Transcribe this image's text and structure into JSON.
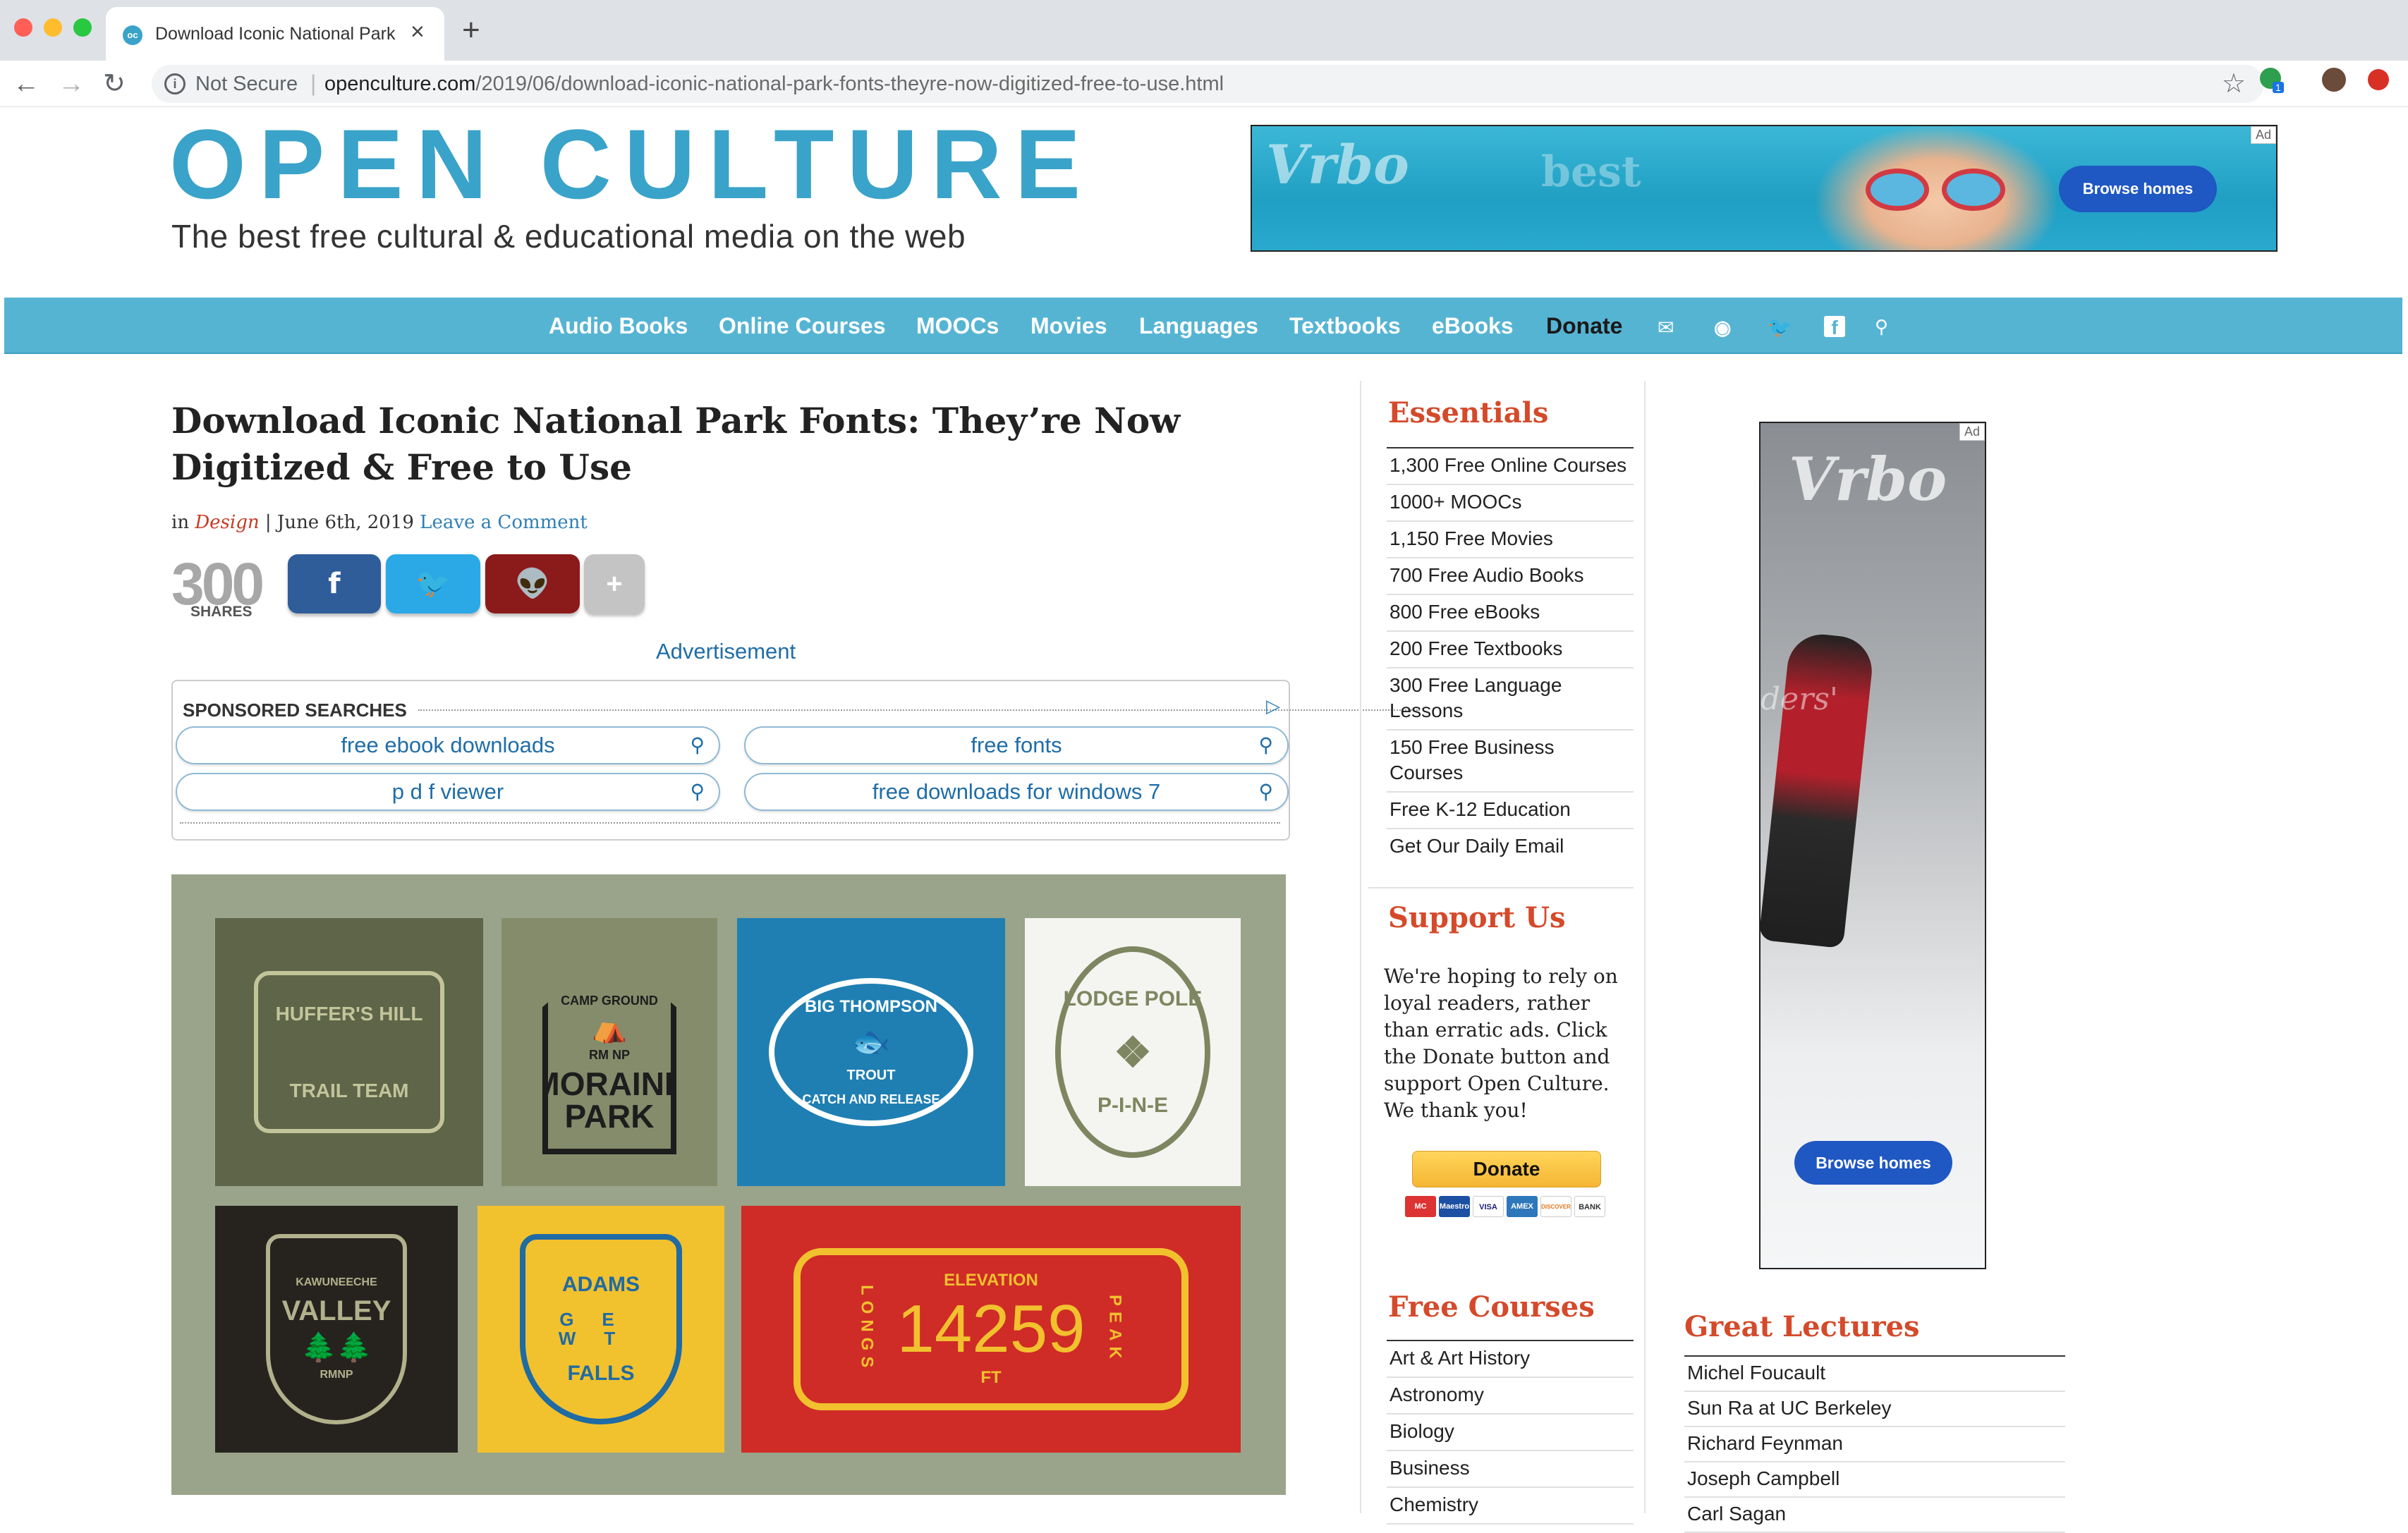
{
  "browser": {
    "tab_title": "Download Iconic National Park",
    "tab_favicon": "oc",
    "url_security": "Not Secure",
    "url_host": "openculture.com",
    "url_path": "/2019/06/download-iconic-national-park-fonts-theyre-now-digitized-free-to-use.html",
    "extension_badge": "1"
  },
  "header": {
    "logo": "OPEN CULTURE",
    "tagline": "The best free cultural & educational media on the web"
  },
  "top_ad": {
    "brand": "Vrbo",
    "text": "best",
    "button": "Browse homes",
    "ad_tag": "Ad"
  },
  "nav": {
    "items": [
      "Audio Books",
      "Online Courses",
      "MOOCs",
      "Movies",
      "Languages",
      "Textbooks",
      "eBooks",
      "Donate"
    ],
    "icons": [
      "mail-icon",
      "rss-icon",
      "twitter-icon",
      "facebook-icon",
      "search-icon"
    ]
  },
  "article": {
    "title": "Download Iconic National Park Fonts: They’re Now Digitized & Free to Use",
    "meta_in": "in",
    "category": "Design",
    "date": " | June 6th, 2019 ",
    "comment_link": "Leave a Comment",
    "share_count": "300",
    "share_label": "SHARES",
    "share_buttons": {
      "facebook": "f",
      "twitter": "t",
      "reddit": "r",
      "more": "+"
    },
    "advertisement_label": "Advertisement"
  },
  "sponsored": {
    "label": "SPONSORED SEARCHES",
    "searches": [
      "free ebook downloads",
      "free fonts",
      "p d f viewer",
      "free downloads for windows 7"
    ]
  },
  "poster": {
    "tiles": [
      {
        "text_top": "HUFFER'S HILL",
        "text_bottom": "TRAIL TEAM",
        "bg": "#5f6549",
        "fg": "#c2c59a"
      },
      {
        "text_top": "CAMP GROUND",
        "text_mid": "RM NP",
        "text_bottom": "MORAINE PARK",
        "bg": "#858c6b",
        "fg": "#1d1d1d"
      },
      {
        "text_top": "BIG THOMPSON",
        "text_mid": "TROUT",
        "text_bottom": "CATCH AND RELEASE",
        "bg": "#1f7fb3",
        "fg": "#ffffff"
      },
      {
        "text_top": "LODGE POLE",
        "text_bottom": "P-I-N-E",
        "bg": "#f4f4f0",
        "fg": "#7d8660"
      },
      {
        "text_top": "KAWUNEECHE",
        "text_mid": "VALLEY",
        "text_bottom": "RMNP",
        "bg": "#26231f",
        "fg": "#b1b18c"
      },
      {
        "text_top": "ADAMS",
        "text_mid": "GE WT",
        "text_bottom": "FALLS",
        "bg": "#f2c12e",
        "fg": "#1f6ba3"
      },
      {
        "text_top": "ELEVATION",
        "text_mid": "14259",
        "text_bottom": "FT",
        "side_left": "LONGS",
        "side_right": "PEAK",
        "bg": "#cf2b27",
        "fg": "#f2c12e"
      }
    ]
  },
  "sidebar": {
    "essentials_title": "Essentials",
    "essentials": [
      "1,300 Free Online Courses",
      "1000+ MOOCs",
      "1,150 Free Movies",
      "700 Free Audio Books",
      "800 Free eBooks",
      "200 Free Textbooks",
      "300 Free Language Lessons",
      "150 Free Business Courses",
      "Free K-12 Education",
      "Get Our Daily Email"
    ],
    "support_title": "Support Us",
    "support_text": "We're hoping to rely on loyal readers, rather than erratic ads. Click the Donate button and support Open Culture. We thank you!",
    "donate_button": "Donate",
    "cards": [
      "MC",
      "Maestro",
      "VISA",
      "AMEX",
      "DISCOVER",
      "BANK"
    ],
    "free_courses_title": "Free Courses",
    "free_courses": [
      "Art & Art History",
      "Astronomy",
      "Biology",
      "Business",
      "Chemistry"
    ]
  },
  "side_ad": {
    "brand": "Vrbo",
    "overlay_text": "ders'",
    "button": "Browse homes",
    "ad_tag": "Ad"
  },
  "lectures": {
    "title": "Great Lectures",
    "items": [
      "Michel Foucault",
      "Sun Ra at UC Berkeley",
      "Richard Feynman",
      "Joseph Campbell",
      "Carl Sagan"
    ]
  },
  "colors": {
    "brand_blue": "#3aa3c9",
    "nav_blue": "#56b4d3",
    "section_red": "#d44a2a",
    "facebook": "#2f5d9a",
    "twitter": "#2aa9e6",
    "reddit": "#8b1a1a"
  }
}
